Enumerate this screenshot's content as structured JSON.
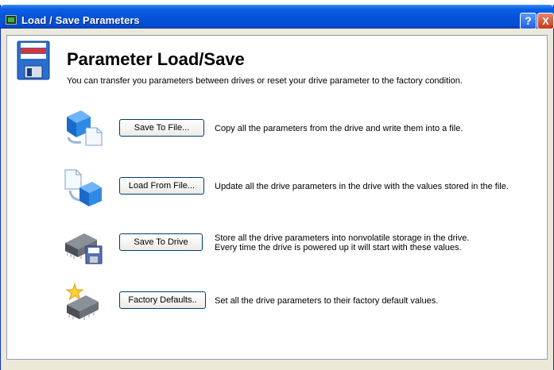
{
  "window": {
    "title": "Load / Save Parameters",
    "help_label": "?",
    "close_label": "X"
  },
  "header": {
    "title": "Parameter Load/Save",
    "subtitle": "You can transfer you parameters between drives or reset your drive parameter to the factory condition."
  },
  "operations": [
    {
      "icon": "cube-to-file-icon",
      "button": "Save To File...",
      "description": "Copy all the parameters from the drive and write them into a file."
    },
    {
      "icon": "file-to-cube-icon",
      "button": "Load From File...",
      "description": "Update all the drive parameters in the drive with the values stored in the file."
    },
    {
      "icon": "chip-floppy-icon",
      "button": "Save To Drive",
      "description": "Store all the drive parameters into nonvolatile storage in the drive.",
      "description2": "Every time the drive is powered up it will start with these values."
    },
    {
      "icon": "chip-sparkle-icon",
      "button": "Factory Defaults..",
      "description": "Set all the drive parameters to their factory default values."
    }
  ],
  "colors": {
    "titlebar": "#0553d8",
    "window_bg": "#ece9d8",
    "content_bg": "#ffffff",
    "cube": "#1f7fd6"
  }
}
